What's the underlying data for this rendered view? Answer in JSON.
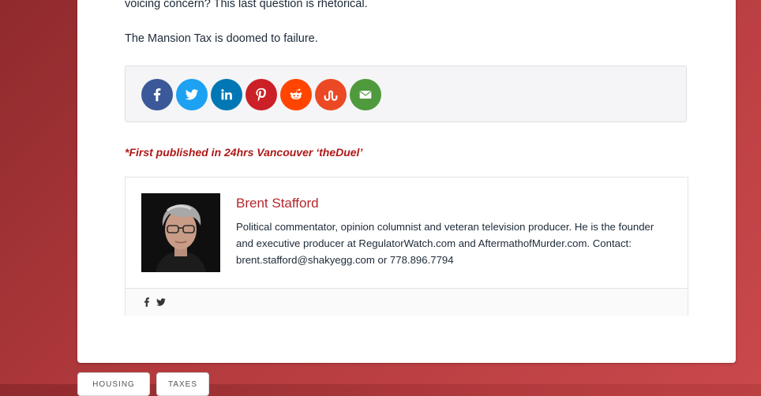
{
  "article": {
    "para_rhetorical": "voicing concern? This last question is rhetorical.",
    "para_conclusion": "The Mansion Tax is doomed to failure.",
    "published_note": "*First published in 24hrs Vancouver ‘theDuel’"
  },
  "share": {
    "buttons": [
      {
        "network": "facebook",
        "icon": "facebook-icon",
        "color": "#3b5998"
      },
      {
        "network": "twitter",
        "icon": "twitter-icon",
        "color": "#1da1f2"
      },
      {
        "network": "linkedin",
        "icon": "linkedin-icon",
        "color": "#0077b5"
      },
      {
        "network": "pinterest",
        "icon": "pinterest-icon",
        "color": "#cb2027"
      },
      {
        "network": "reddit",
        "icon": "reddit-icon",
        "color": "#ff4500"
      },
      {
        "network": "stumbleupon",
        "icon": "stumbleupon-icon",
        "color": "#eb4924"
      },
      {
        "network": "email",
        "icon": "email-icon",
        "color": "#4e9a3d"
      }
    ]
  },
  "author": {
    "name": "Brent Stafford",
    "bio": "Political commentator, opinion columnist and veteran television producer. He is the founder and executive producer at RegulatorWatch.com and AftermathofMurder.com. Contact: brent.stafford@shakyegg.com or 778.896.7794",
    "social": [
      {
        "network": "facebook",
        "icon": "facebook-icon"
      },
      {
        "network": "twitter",
        "icon": "twitter-icon"
      }
    ]
  },
  "tags": [
    {
      "label": "HOUSING"
    },
    {
      "label": "TAXES"
    }
  ],
  "colors": {
    "background": "#b23a3d",
    "accent_red": "#b01818",
    "author_name": "#b3262b",
    "text": "#1d2a38"
  }
}
